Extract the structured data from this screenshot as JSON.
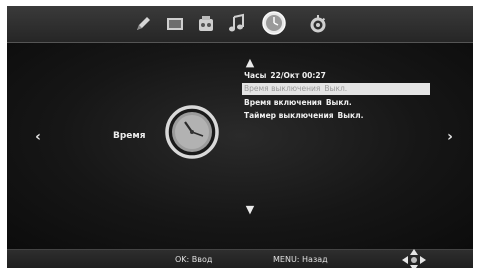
{
  "top_bar": {
    "icons": [
      "pencil-icon",
      "screen-icon",
      "audio-icon",
      "music-icon",
      "clock-icon",
      "gear-icon"
    ],
    "active_icon": "clock-icon"
  },
  "main": {
    "section_label": "Время",
    "nav_left": "‹",
    "nav_right": "›",
    "scroll_up": "▲",
    "scroll_down": "▼",
    "menu": [
      {
        "label": "Часы",
        "value": "22/Окт   00:27"
      },
      {
        "label": "Время выключения",
        "value": "Выкл."
      },
      {
        "label": "Время включения",
        "value": "Выкл."
      },
      {
        "label": "Таймер выключения",
        "value": "Выкл."
      }
    ],
    "selected_index": 1
  },
  "bottom_bar": {
    "ok_hint": "OK: Ввод",
    "menu_hint": "MENU: Назад"
  },
  "colors": {
    "background": "#0e0e0e",
    "text": "#f0f0f0",
    "highlight": "#e4e4e4",
    "highlight_text": "#9a9a9a"
  }
}
